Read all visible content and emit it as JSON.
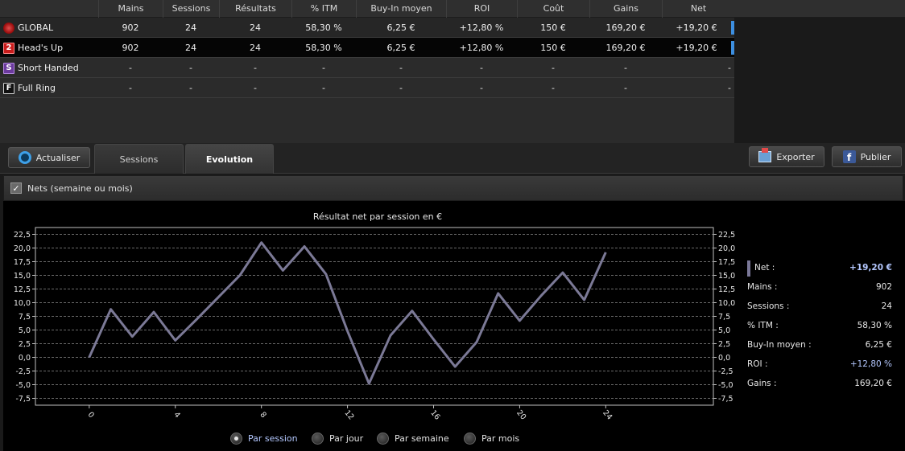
{
  "table": {
    "headers": [
      "Mains",
      "Sessions",
      "Résultats",
      "% ITM",
      "Buy-In moyen",
      "ROI",
      "Coût",
      "Gains",
      "Net"
    ],
    "rows": [
      {
        "name": "GLOBAL",
        "badge": "",
        "cells": [
          "902",
          "24",
          "24",
          "58,30 %",
          "6,25 €",
          "+12,80 %",
          "150 €",
          "169,20 €",
          "+19,20 €"
        ]
      },
      {
        "name": "Head's Up",
        "badge": "2",
        "cells": [
          "902",
          "24",
          "24",
          "58,30 %",
          "6,25 €",
          "+12,80 %",
          "150 €",
          "169,20 €",
          "+19,20 €"
        ]
      },
      {
        "name": "Short Handed",
        "badge": "S",
        "cells": [
          "-",
          "-",
          "-",
          "-",
          "-",
          "-",
          "-",
          "-",
          "-"
        ]
      },
      {
        "name": "Full Ring",
        "badge": "F",
        "cells": [
          "-",
          "-",
          "-",
          "-",
          "-",
          "-",
          "-",
          "-",
          "-"
        ]
      }
    ]
  },
  "toolbar": {
    "refresh_label": "Actualiser",
    "tab_sessions": "Sessions",
    "tab_evolution": "Evolution",
    "export_label": "Exporter",
    "publish_label": "Publier",
    "fb_glyph": "f"
  },
  "options": {
    "nets_checkbox_label": "Nets (semaine ou mois)",
    "nets_checked": true,
    "check_glyph": "✓"
  },
  "chart_data": {
    "type": "line",
    "title": "Résultat net par session en €",
    "x": [
      0,
      1,
      2,
      3,
      4,
      5,
      6,
      7,
      8,
      9,
      10,
      11,
      12,
      13,
      14,
      15,
      16,
      17,
      18,
      19,
      20,
      21,
      22,
      23,
      24
    ],
    "series": [
      {
        "values": [
          0,
          8.8,
          3.8,
          8.3,
          3.1,
          7.0,
          11.0,
          15.0,
          21.0,
          15.9,
          20.3,
          15.2,
          4.8,
          -4.8,
          4.0,
          8.5,
          3.3,
          -1.7,
          2.8,
          11.7,
          6.7,
          11.3,
          15.5,
          10.5,
          19.2
        ],
        "color": "#7b7996"
      }
    ],
    "ylim": [
      -8.75,
      23.75
    ],
    "yticks": [
      "22,5",
      "20,0",
      "17,5",
      "15,0",
      "12,5",
      "10,0",
      "7,5",
      "5,0",
      "2,5",
      "0,0",
      "-2,5",
      "-5,0",
      "-7,5"
    ],
    "ytick_values": [
      22.5,
      20.0,
      17.5,
      15.0,
      12.5,
      10.0,
      7.5,
      5.0,
      2.5,
      0.0,
      -2.5,
      -5.0,
      -7.5
    ],
    "xticks": [
      "0",
      "4",
      "8",
      "12",
      "16",
      "20",
      "24"
    ],
    "xtick_values": [
      0,
      4,
      8,
      12,
      16,
      20,
      24
    ],
    "grid": true,
    "grid_style": "dashed",
    "dual_y_axis": true
  },
  "summary": {
    "items": [
      {
        "label": "Net :",
        "value": "+19,20 €"
      },
      {
        "label": "Mains :",
        "value": "902"
      },
      {
        "label": "Sessions :",
        "value": "24"
      },
      {
        "label": "% ITM :",
        "value": "58,30 %"
      },
      {
        "label": "Buy-In moyen :",
        "value": "6,25 €"
      },
      {
        "label": "ROI :",
        "value": "+12,80 %"
      },
      {
        "label": "Gains :",
        "value": "169,20 €"
      }
    ]
  },
  "radios": {
    "options": [
      "Par session",
      "Par jour",
      "Par semaine",
      "Par mois"
    ],
    "selected": "Par session"
  },
  "colors": {
    "net_bar": "#3d8fe0",
    "line": "#7b7996",
    "highlight_text": "#b4c8ff"
  }
}
